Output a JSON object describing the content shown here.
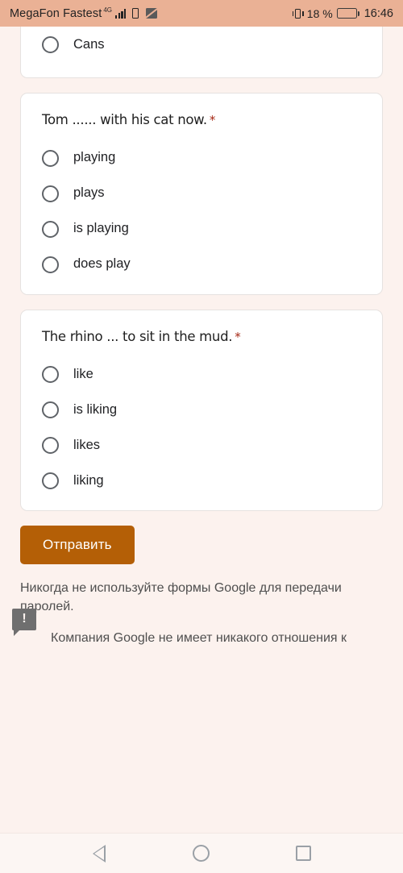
{
  "status_bar": {
    "carrier": "MegaFon Fastest",
    "network_type": "4G",
    "battery_percent": "18 %",
    "battery_level": 18,
    "clock": "16:46",
    "icons": [
      "signal-bars-icon",
      "sim-card-icon",
      "no-photo-icon",
      "vibrate-icon",
      "battery-icon"
    ],
    "background_color": "#eab195"
  },
  "form": {
    "required_marker": "*",
    "cards": [
      {
        "id": "card-clipped",
        "question": "",
        "clipped": true,
        "options": [
          {
            "label": "Cans",
            "selected": false
          }
        ]
      },
      {
        "id": "card-tom",
        "question": "Tom ...... with his cat now.",
        "clipped": false,
        "options": [
          {
            "label": "playing",
            "selected": false
          },
          {
            "label": "plays",
            "selected": false
          },
          {
            "label": "is playing",
            "selected": false
          },
          {
            "label": "does play",
            "selected": false
          }
        ]
      },
      {
        "id": "card-rhino",
        "question": "The rhino ... to sit in the mud.",
        "clipped": false,
        "options": [
          {
            "label": "like",
            "selected": false
          },
          {
            "label": "is liking",
            "selected": false
          },
          {
            "label": "likes",
            "selected": false
          },
          {
            "label": "liking",
            "selected": false
          }
        ]
      }
    ],
    "submit_label": "Отправить",
    "submit_color": "#b45f06"
  },
  "footer": {
    "line1": "Никогда не используйте формы Google для передачи паролей.",
    "line2": "Компания Google не имеет никакого отношения к",
    "report_icon": "report-flag-icon"
  },
  "nav_bar": {
    "back": "back-icon",
    "home": "home-icon",
    "recents": "recents-icon"
  },
  "theme": {
    "page_background": "#fcf2ee",
    "card_background": "#ffffff",
    "required_star_color": "#a52714",
    "radio_border_color": "#5f6368"
  }
}
